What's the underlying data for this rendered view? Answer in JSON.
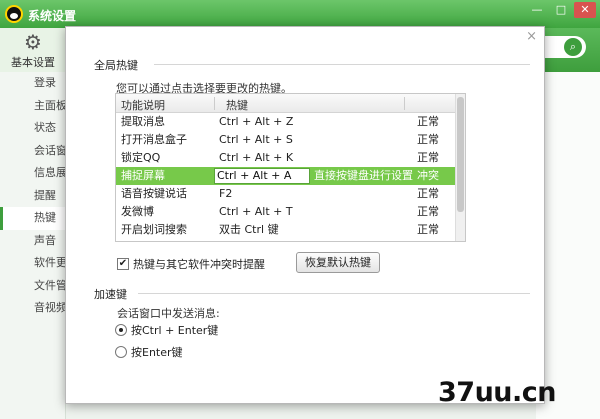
{
  "window": {
    "title": "系统设置",
    "controls": [
      "—",
      "□",
      "✕"
    ]
  },
  "toolbar": {
    "basic_label": "基本设置",
    "search_icon": "search-icon"
  },
  "sidebar": {
    "items": [
      {
        "label": "登录",
        "active": false
      },
      {
        "label": "主面板",
        "active": false
      },
      {
        "label": "状态",
        "active": false
      },
      {
        "label": "会话窗口",
        "active": false
      },
      {
        "label": "信息展示",
        "active": false
      },
      {
        "label": "提醒",
        "active": false
      },
      {
        "label": "热键",
        "active": true
      },
      {
        "label": "声音",
        "active": false
      },
      {
        "label": "软件更新",
        "active": false
      },
      {
        "label": "文件管理",
        "active": false
      },
      {
        "label": "音视频",
        "active": false
      }
    ]
  },
  "dialog": {
    "close_label": "×",
    "global_section": "全局热键",
    "hint": "您可以通过点击选择要更改的热键。",
    "columns": {
      "func": "功能说明",
      "key": "热键"
    },
    "rows": [
      {
        "func": "提取消息",
        "key": "Ctrl + Alt + Z",
        "status": "正常"
      },
      {
        "func": "打开消息盒子",
        "key": "Ctrl + Alt + S",
        "status": "正常"
      },
      {
        "func": "锁定QQ",
        "key": "Ctrl + Alt + K",
        "status": "正常"
      },
      {
        "func": "语音按键说话",
        "key": "F2",
        "status": "正常"
      },
      {
        "func": "发微博",
        "key": "Ctrl + Alt + T",
        "status": "正常"
      },
      {
        "func": "开启划词搜索",
        "key": "双击 Ctrl 键",
        "status": "正常"
      }
    ],
    "selected_row": {
      "func": "捕捉屏幕",
      "key_value": "Ctrl + Alt + A",
      "tip": "直接按键盘进行设置",
      "status": "冲突"
    },
    "conflict_check_label": "热键与其它软件冲突时提醒",
    "conflict_checked": true,
    "restore_button": "恢复默认热键",
    "accel_section": "加速键",
    "send_label": "会话窗口中发送消息:",
    "radio_options": [
      {
        "label": "按Ctrl + Enter键",
        "checked": true
      },
      {
        "label": "按Enter键",
        "checked": false
      }
    ]
  },
  "watermark": "37uu.cn"
}
